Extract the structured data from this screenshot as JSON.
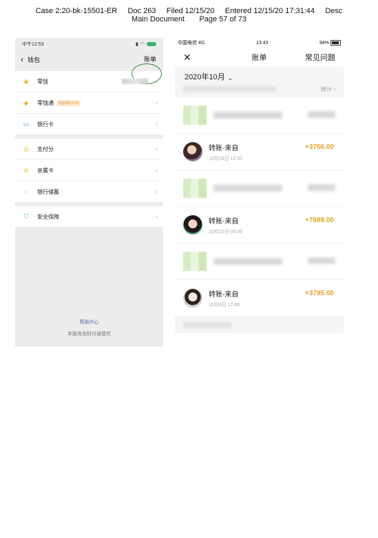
{
  "header": {
    "line1": "Case 2:20-bk-15501-ER     Doc 263     Filed 12/15/20     Entered 12/15/20 17:31:44     Desc",
    "line2": "Main Document       Page 57 of 73"
  },
  "left_phone": {
    "status_time": "中午12:53",
    "title": "钱包",
    "bill_label": "账单",
    "group1": [
      {
        "label": "零钱",
        "icon": "coin-icon"
      },
      {
        "label": "零钱通",
        "badge": "收益率1.97%",
        "icon": "diamond-icon"
      },
      {
        "label": "银行卡",
        "icon": "card-icon"
      }
    ],
    "group2": [
      {
        "label": "支付分",
        "icon": "score-icon"
      },
      {
        "label": "亲属卡",
        "icon": "family-card-icon"
      },
      {
        "label": "银行储蓄",
        "icon": "bank-icon"
      }
    ],
    "group3": [
      {
        "label": "安全保障",
        "icon": "shield-icon"
      }
    ],
    "footer_help": "帮助中心",
    "footer_note": "本服务由财付通提供"
  },
  "right_phone": {
    "carrier": "中国电信  4G",
    "time": "13:43",
    "battery": "94%",
    "title": "账单",
    "faq": "常见问题",
    "month": "2020年10月",
    "stat_label": "统计 ›",
    "transactions": [
      {
        "title": "转账-来自",
        "date": "10月29日 12:53",
        "amount": "+3756.00"
      },
      {
        "title": "转账-来自",
        "date": "10月13日 09:36",
        "amount": "+7689.00"
      },
      {
        "title": "转账-来自",
        "date": "10月8日 12:48",
        "amount": "+3795.00"
      }
    ],
    "accent": "#e2a32a"
  }
}
